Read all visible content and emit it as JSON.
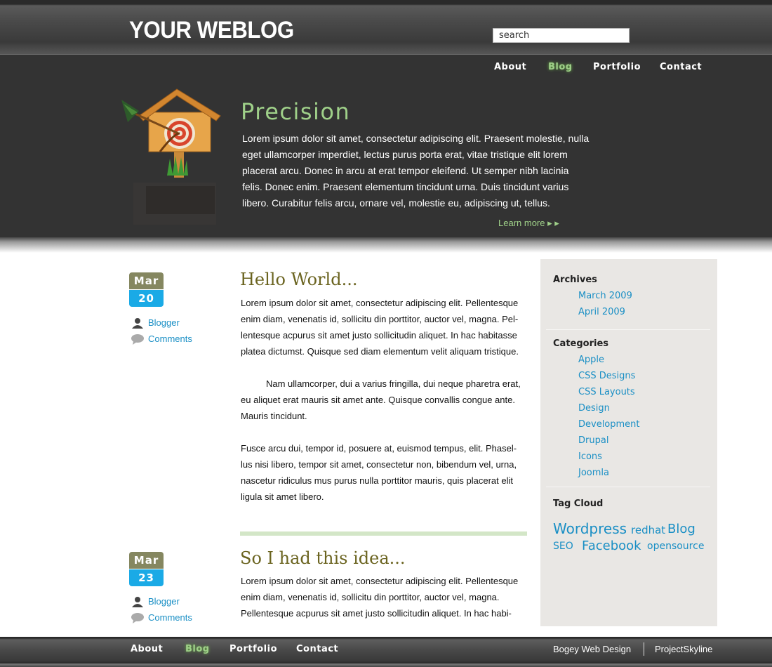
{
  "header": {
    "logo": "YOUR WEBLOG",
    "search_value": "search"
  },
  "nav": {
    "items": [
      "About",
      "Blog",
      "Portfolio",
      "Contact"
    ],
    "active": "Blog"
  },
  "hero": {
    "title": "Precision",
    "text": "Lorem ipsum dolor sit amet, consectetur adipiscing elit. Praesent molestie, nulla eget ullamcorper imperdiet, lectus purus porta erat, vitae tristique elit lorem placerat arcu. Donec in arcu at erat tempor eleifend. Ut semper nibh lacinia felis. Donec enim. Praesent elementum tincidunt urna. Duis tincidunt varius libero. Curabitur felis arcu, ornare vel, molestie eu, adipiscing ut, tellus.",
    "learn_more": "Learn more ▸ ▸"
  },
  "posts": [
    {
      "month": "Mar",
      "day": "20",
      "author": "Blogger",
      "comments": "Comments",
      "title": "Hello World...",
      "paragraphs": [
        "Lorem ipsum dolor sit amet, consectetur adipiscing elit. Pellentesque enim diam, venenatis id, sollicitu din porttitor, auctor vel, magna. Pel-lentesque acpurus sit amet justo sollicitudin aliquet. In hac habitasse platea dictumst. Quisque sed diam elementum velit aliquam tristique.",
        "Nam ullamcorper, dui a varius fringilla, dui neque pharetra erat, eu aliquet erat mauris sit amet ante. Quisque convallis congue ante. Mauris tincidunt.",
        "Fusce arcu dui, tempor id, posuere at, euismod tempus, elit. Phasel-lus nisi libero, tempor sit amet, consectetur non, bibendum vel, urna, nascetur ridiculus mus purus nulla porttitor mauris, quis placerat elit ligula sit amet libero."
      ]
    },
    {
      "month": "Mar",
      "day": "23",
      "author": "Blogger",
      "comments": "Comments",
      "title": "So I had this idea...",
      "paragraphs": [
        "Lorem ipsum dolor sit amet, consectetur adipiscing elit. Pellentesque enim diam, venenatis id, sollicitu din porttitor, auctor vel, magna. Pellentesque acpurus sit amet justo sollicitudin aliquet. In hac habi-"
      ]
    }
  ],
  "sidebar": {
    "archives_title": "Archives",
    "archives": [
      "March 2009",
      "April 2009"
    ],
    "categories_title": "Categories",
    "categories": [
      "Apple",
      "CSS Designs",
      "CSS Layouts",
      "Design",
      "Development",
      "Drupal",
      "Icons",
      "Joomla"
    ],
    "tagcloud_title": "Tag Cloud",
    "tags": [
      "Wordpress",
      "redhat",
      "Blog",
      "SEO",
      "Facebook",
      "opensource"
    ]
  },
  "footer": {
    "nav": [
      "About",
      "Blog",
      "Portfolio",
      "Contact"
    ],
    "credit_left": "Bogey Web Design",
    "credit_right": "ProjectSkyline"
  },
  "colors": {
    "accent_green": "#9fd089",
    "link_blue": "#1a8fc5",
    "date_month": "#858760",
    "date_day": "#1aaae6",
    "post_title": "#6b6420"
  }
}
